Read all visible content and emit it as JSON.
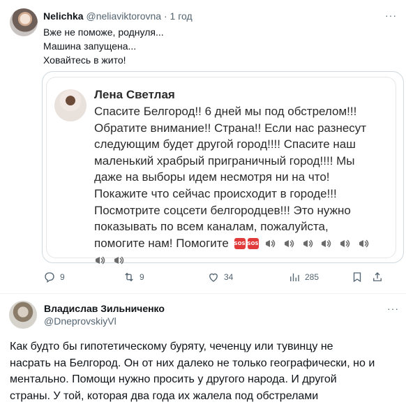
{
  "tweet": {
    "author_name": "Nelichka",
    "author_handle": "@neliaviktorovna",
    "separator": "·",
    "time": "1 год",
    "lines": [
      "Вже не поможе, роднуля...",
      "Машина запущена...",
      "Ховайтесь в жито!"
    ]
  },
  "quote": {
    "author_name": "Лена Светлая",
    "lines": [
      "Спасите Белгород!! 6 дней мы под обстрелом!!!",
      "Обратите внимание!! Страна!! Если нас разнесут",
      "следующим будет другой город!!!! Спасите наш",
      "маленький храбрый приграничный город!!!! Мы",
      "даже на выборы идем несмотря ни на что!",
      "Покажите что сейчас происходит в городе!!!",
      "Посмотрите соцсети белгородцев!!! Это нужно",
      "показывать по всем каналам, пожалуйста,",
      "помогите нам! Помогите"
    ],
    "sos_label": "SOS"
  },
  "actions": {
    "replies": "9",
    "retweets": "9",
    "likes": "34",
    "views": "285"
  },
  "comment": {
    "author_name": "Владислав Зильниченко",
    "author_handle": "@DneprovskiyVl",
    "more": "···",
    "lines": [
      "Как будто бы гипотетическому буряту, чеченцу или тувинцу не",
      "насрать на Белгород. Он от них далеко не только географически, но и",
      "ментально. Помощи нужно просить у другого народа. И другой",
      "страны. У той, которая два года их жалела под обстрелами"
    ]
  },
  "icons": [
    "more-icon",
    "reply-icon",
    "retweet-icon",
    "like-icon",
    "views-icon",
    "bookmark-icon",
    "share-icon",
    "sos-emoji-icon",
    "loudspeaker-emoji-icon"
  ]
}
